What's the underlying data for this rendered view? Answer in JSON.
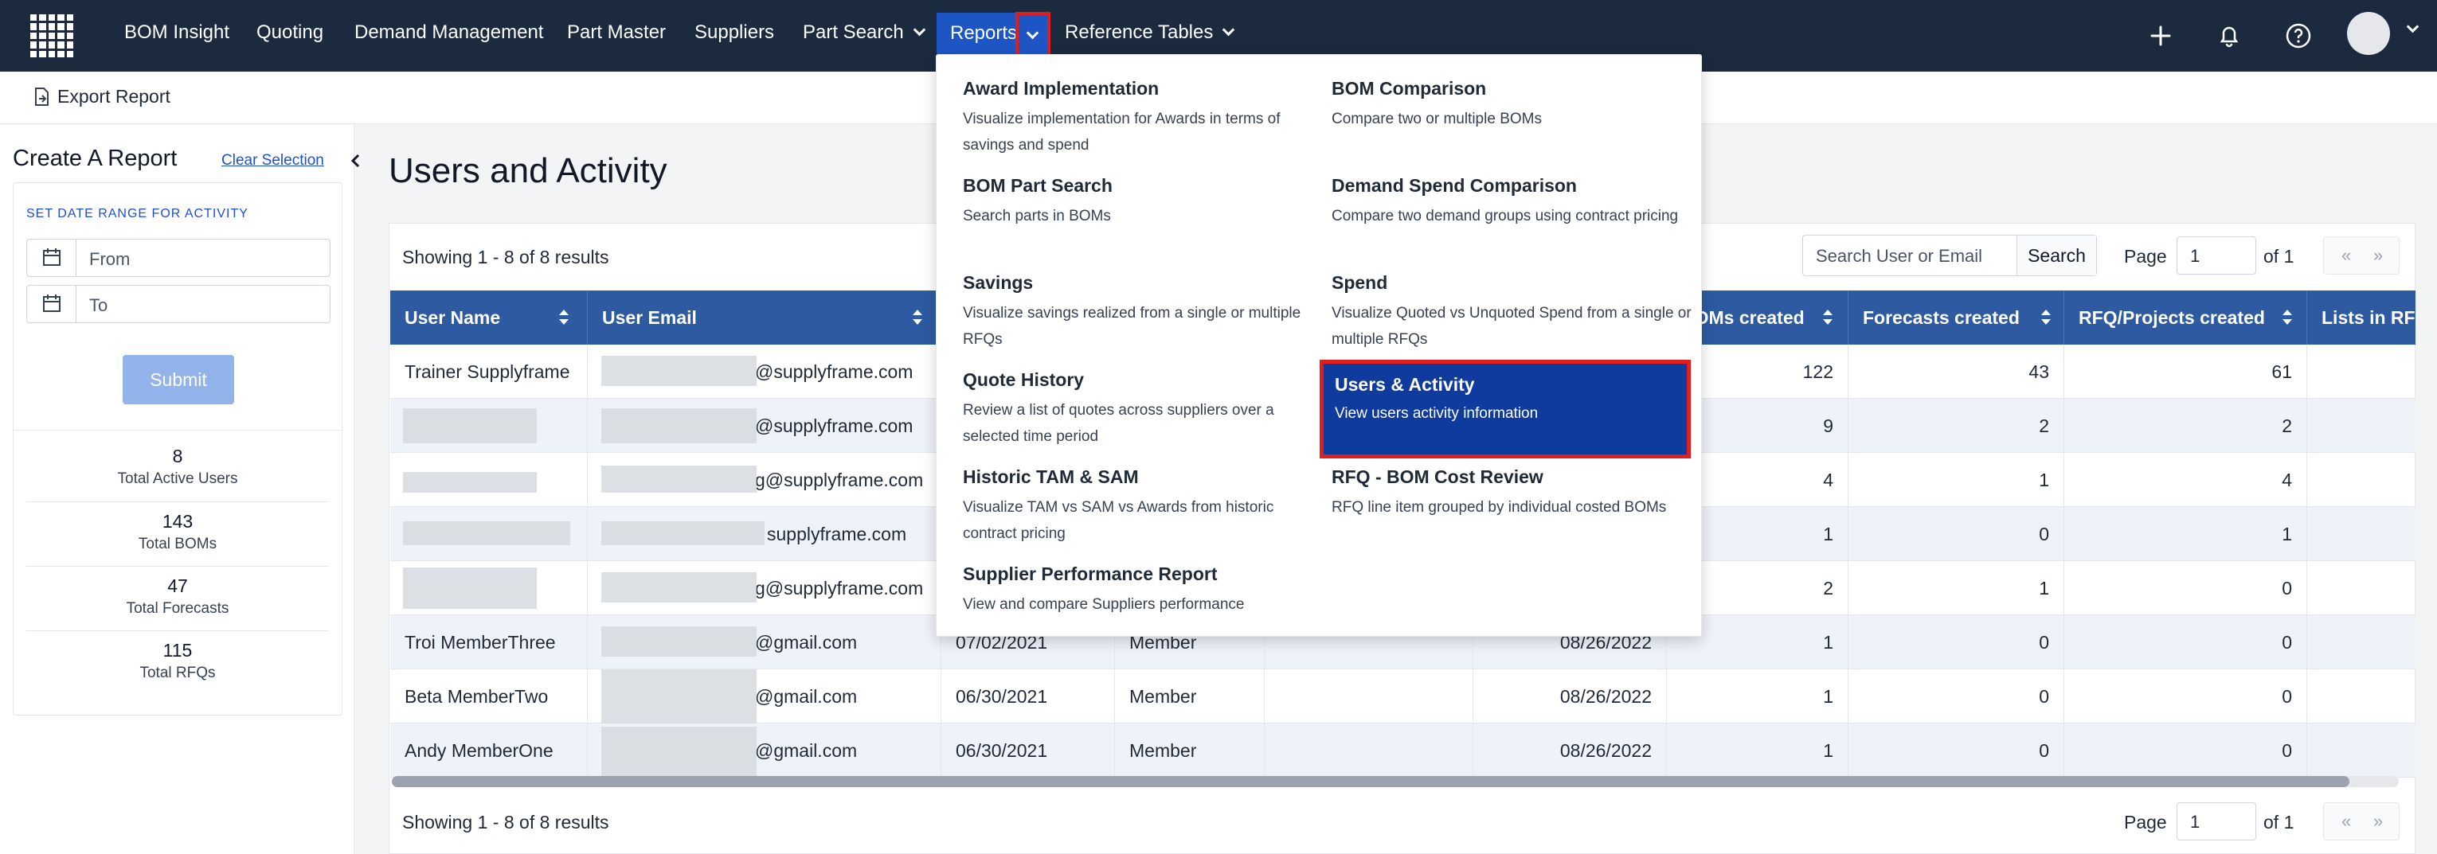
{
  "nav": {
    "items": [
      "BOM Insight",
      "Quoting",
      "Demand Management",
      "Part Master",
      "Suppliers",
      "Part Search",
      "Reports",
      "Reference Tables"
    ],
    "accent": "#1d55c4"
  },
  "subbar": {
    "export_label": "Export Report"
  },
  "sidebar": {
    "title": "Create A Report",
    "clear_label": "Clear Selection",
    "date_label": "SET DATE RANGE FOR ACTIVITY",
    "from_placeholder": "From",
    "to_placeholder": "To",
    "submit_label": "Submit",
    "stats": [
      {
        "value": "8",
        "label": "Total Active Users"
      },
      {
        "value": "143",
        "label": "Total BOMs"
      },
      {
        "value": "47",
        "label": "Total Forecasts"
      },
      {
        "value": "115",
        "label": "Total RFQs"
      }
    ]
  },
  "main": {
    "title": "Users and Activity",
    "showing": "Showing 1 - 8 of 8 results",
    "search_placeholder": "Search User or Email",
    "search_button": "Search",
    "page_label": "Page",
    "page_value": "1",
    "page_of": "of 1",
    "prev": "«",
    "next": "»"
  },
  "table": {
    "headers": [
      "User Name",
      "User Email",
      "",
      "",
      "",
      "",
      "BOMs created",
      "Forecasts created",
      "RFQ/Projects created",
      "Lists in RFQ"
    ],
    "rows": [
      {
        "name": "Trainer Supplyframe",
        "email": "@supplyframe.com",
        "date": "",
        "role": "",
        "last": "",
        "boms": "122",
        "forecasts": "43",
        "rfqs": "61"
      },
      {
        "name": "",
        "email": "@supplyframe.com",
        "date": "",
        "role": "",
        "last": "",
        "boms": "9",
        "forecasts": "2",
        "rfqs": "2"
      },
      {
        "name": "",
        "email": "g@supplyframe.com",
        "date": "",
        "role": "",
        "last": "",
        "boms": "4",
        "forecasts": "1",
        "rfqs": "4"
      },
      {
        "name": "",
        "email": "supplyframe.com",
        "date": "",
        "role": "",
        "last": "",
        "boms": "1",
        "forecasts": "0",
        "rfqs": "1"
      },
      {
        "name": "",
        "email": "g@supplyframe.com",
        "date": "",
        "role": "",
        "last": "",
        "boms": "2",
        "forecasts": "1",
        "rfqs": "0"
      },
      {
        "name": "Troi MemberThree",
        "email": "@gmail.com",
        "date": "07/02/2021",
        "role": "Member",
        "last": "08/26/2022",
        "boms": "1",
        "forecasts": "0",
        "rfqs": "0"
      },
      {
        "name": "Beta MemberTwo",
        "email": "@gmail.com",
        "date": "06/30/2021",
        "role": "Member",
        "last": "08/26/2022",
        "boms": "1",
        "forecasts": "0",
        "rfqs": "0"
      },
      {
        "name": "Andy MemberOne",
        "email": "@gmail.com",
        "date": "06/30/2021",
        "role": "Member",
        "last": "08/26/2022",
        "boms": "1",
        "forecasts": "0",
        "rfqs": "0"
      }
    ]
  },
  "dropdown": {
    "left": [
      {
        "title": "Award Implementation",
        "desc": "Visualize implementation for Awards in terms of savings and spend"
      },
      {
        "title": "BOM Part Search",
        "desc": "Search parts in BOMs"
      },
      {
        "title": "Savings",
        "desc": "Visualize savings realized from a single or multiple RFQs"
      },
      {
        "title": "Quote History",
        "desc": "Review a list of quotes across suppliers over a selected time period"
      },
      {
        "title": "Historic TAM & SAM",
        "desc": "Visualize TAM vs SAM vs Awards from historic contract pricing"
      },
      {
        "title": "Supplier Performance Report",
        "desc": "View and compare Suppliers performance"
      }
    ],
    "right": [
      {
        "title": "BOM Comparison",
        "desc": "Compare two or multiple BOMs"
      },
      {
        "title": "Demand Spend Comparison",
        "desc": "Compare two demand groups using contract pricing"
      },
      {
        "title": "Spend",
        "desc": "Visualize Quoted vs Unquoted Spend from a single or multiple RFQs"
      },
      {
        "title": "Users & Activity",
        "desc": "View users activity information"
      },
      {
        "title": "RFQ - BOM Cost Review",
        "desc": "RFQ line item grouped by individual costed BOMs"
      }
    ]
  }
}
